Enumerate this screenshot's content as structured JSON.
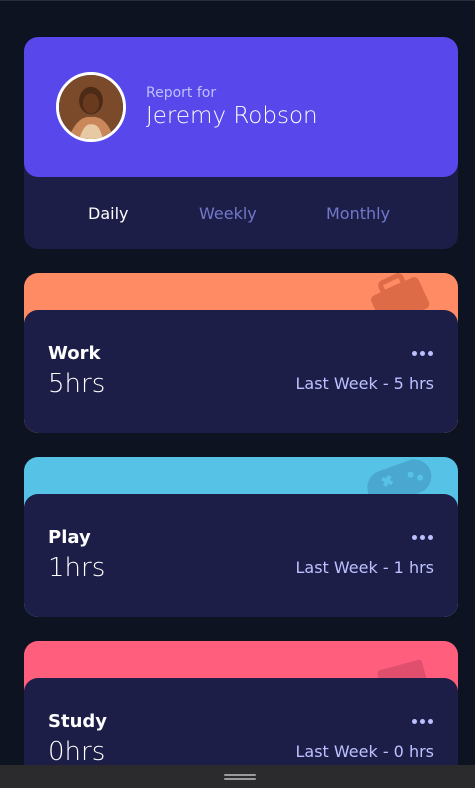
{
  "profile": {
    "report_for": "Report for",
    "name": "Jeremy Robson"
  },
  "tabs": [
    {
      "label": "Daily",
      "active": true
    },
    {
      "label": "Weekly",
      "active": false
    },
    {
      "label": "Monthly",
      "active": false
    }
  ],
  "cards": [
    {
      "title": "Work",
      "hours": "5hrs",
      "last_week": "Last Week - 5 hrs",
      "color": "#ff8b64",
      "icon": "briefcase-icon"
    },
    {
      "title": "Play",
      "hours": "1hrs",
      "last_week": "Last Week - 1 hrs",
      "color": "#55c2e6",
      "icon": "gamepad-icon"
    },
    {
      "title": "Study",
      "hours": "0hrs",
      "last_week": "Last Week - 0 hrs",
      "color": "#ff5e7d",
      "icon": "book-icon"
    }
  ],
  "colors": {
    "background": "#0e1322",
    "card": "#1d1e48",
    "accent": "#5847eb",
    "muted_text": "#bdc1ff"
  }
}
